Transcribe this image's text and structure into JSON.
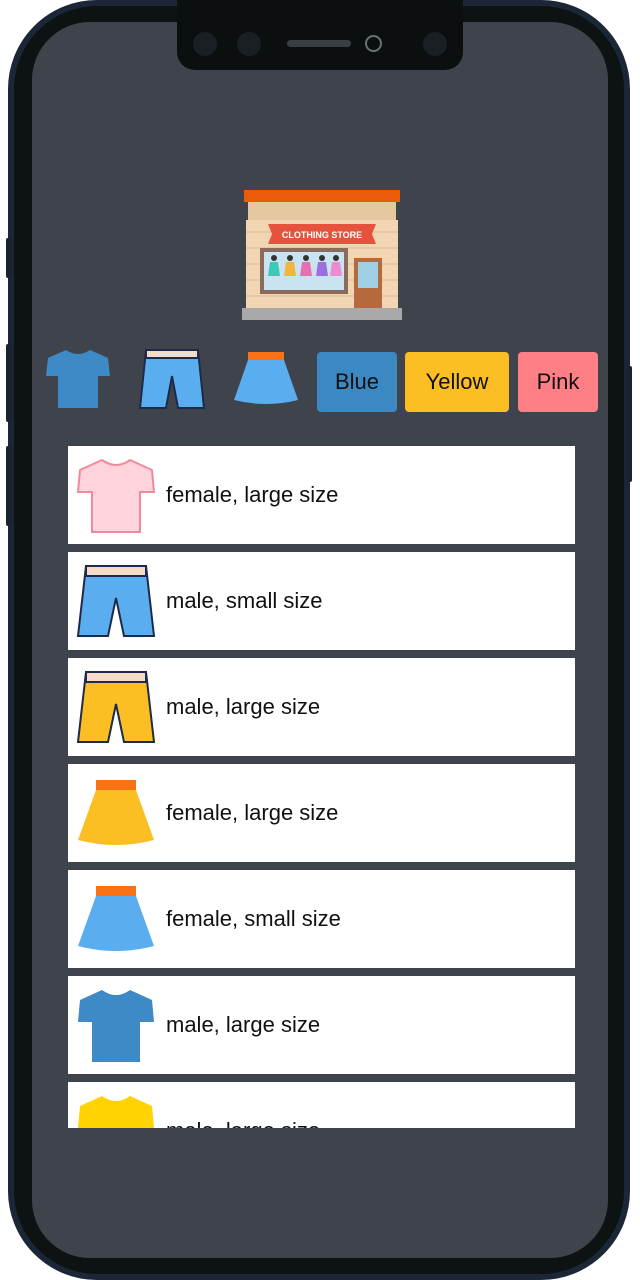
{
  "app": {
    "logo_icon": "clothing-store-icon",
    "logo_text": "CLOTHING STORE"
  },
  "filters": {
    "icons": [
      {
        "name": "tshirt-filter",
        "icon": "tshirt-icon",
        "color": "#3d8ac7"
      },
      {
        "name": "shorts-filter",
        "icon": "shorts-icon",
        "color": "#5aaef0"
      },
      {
        "name": "skirt-filter",
        "icon": "skirt-icon",
        "color": "#5aaef0"
      }
    ],
    "colors": [
      {
        "label": "Blue",
        "color": "#3b88c3"
      },
      {
        "label": "Yellow",
        "color": "#fbbf24"
      },
      {
        "label": "Pink",
        "color": "#ff7f86"
      }
    ]
  },
  "products": [
    {
      "label": "female, large size",
      "icon": "tshirt-icon",
      "color": "#ffd3db"
    },
    {
      "label": "male, small size",
      "icon": "shorts-icon",
      "color": "#5aaef0"
    },
    {
      "label": "male, large size",
      "icon": "shorts-icon",
      "color": "#fbbf24"
    },
    {
      "label": "female, large size",
      "icon": "skirt-icon",
      "color": "#fbbf24"
    },
    {
      "label": "female, small size",
      "icon": "skirt-icon",
      "color": "#5aaef0"
    },
    {
      "label": "male, large size",
      "icon": "tshirt-icon",
      "color": "#3d8ac7"
    },
    {
      "label": "male, large size",
      "icon": "tshirt-icon",
      "color": "#ffd200"
    }
  ]
}
